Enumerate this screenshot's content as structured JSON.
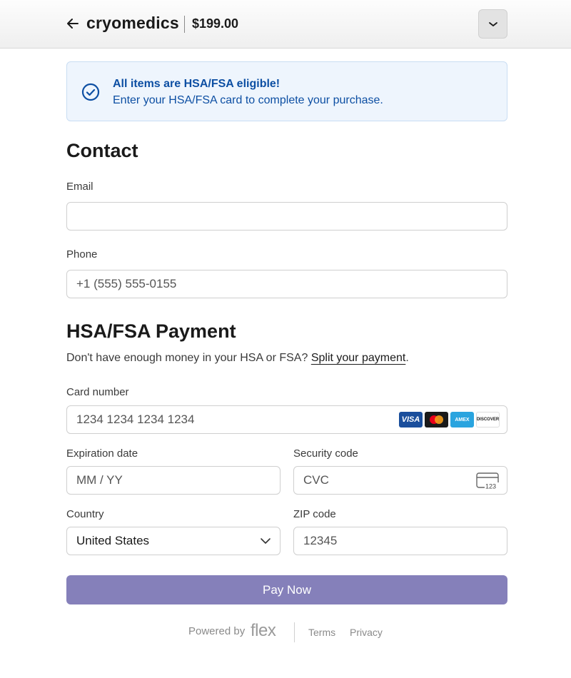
{
  "header": {
    "back_icon": "arrow-left-icon",
    "brand": "cryomedics",
    "price": "$199.00",
    "dropdown_icon": "chevron-down-icon"
  },
  "banner": {
    "icon": "check-circle-icon",
    "title": "All items are HSA/FSA eligible!",
    "text": "Enter your HSA/FSA card to complete your purchase."
  },
  "contact": {
    "title": "Contact",
    "email_label": "Email",
    "email_value": "",
    "phone_label": "Phone",
    "phone_placeholder": "+1 (555) 555-0155"
  },
  "payment": {
    "title": "HSA/FSA Payment",
    "note": "Don't have enough money in your HSA or FSA?",
    "split_link": "Split your payment",
    "card_label": "Card number",
    "card_placeholder": "1234 1234 1234 1234",
    "card_brands": [
      "VISA",
      "Mastercard",
      "AMEX",
      "DISCOVER"
    ],
    "exp_label": "Expiration date",
    "exp_placeholder": "MM / YY",
    "cvc_label": "Security code",
    "cvc_placeholder": "CVC",
    "cvc_icon_text": "123",
    "country_label": "Country",
    "country_value": "United States",
    "zip_label": "ZIP code",
    "zip_placeholder": "12345"
  },
  "pay_button": "Pay Now",
  "footer": {
    "powered": "Powered by",
    "flex": "flex",
    "terms": "Terms",
    "privacy": "Privacy"
  },
  "colors": {
    "accent_blue": "#0d4fa3",
    "pay_button": "#8580ba",
    "banner_bg": "#eef5fd"
  }
}
